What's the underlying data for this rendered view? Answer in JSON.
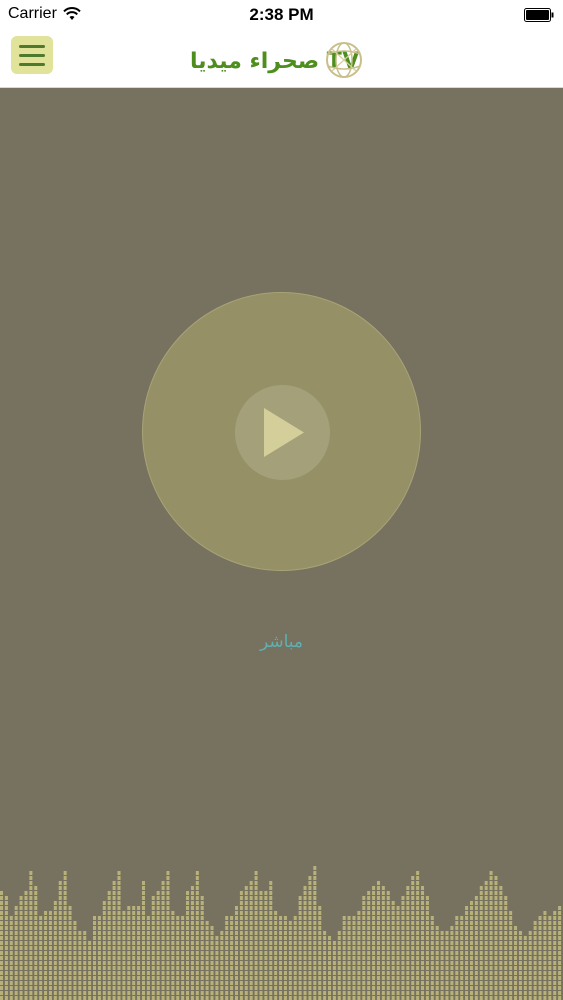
{
  "status": {
    "carrier": "Carrier",
    "time": "2:38 PM"
  },
  "header": {
    "logo_text": "صحراء ميديا TV"
  },
  "player": {
    "live_label": "مباشر"
  },
  "colors": {
    "background": "#777160",
    "accent": "#e1e39a",
    "live": "#5fb0b0",
    "bar": "#b8b27a"
  },
  "equalizer": {
    "levels": [
      0.8,
      0.75,
      0.6,
      0.7,
      0.75,
      0.78,
      0.95,
      0.82,
      0.6,
      0.66,
      0.66,
      0.72,
      0.85,
      0.95,
      0.7,
      0.58,
      0.5,
      0.5,
      0.45,
      0.6,
      0.6,
      0.72,
      0.8,
      0.85,
      0.92,
      0.66,
      0.68,
      0.7,
      0.7,
      0.86,
      0.6,
      0.74,
      0.78,
      0.88,
      0.92,
      0.66,
      0.6,
      0.6,
      0.8,
      0.84,
      0.94,
      0.76,
      0.58,
      0.53,
      0.46,
      0.52,
      0.6,
      0.6,
      0.7,
      0.78,
      0.82,
      0.85,
      0.93,
      0.78,
      0.8,
      0.88,
      0.66,
      0.6,
      0.6,
      0.58,
      0.62,
      0.74,
      0.82,
      0.9,
      0.97,
      0.7,
      0.5,
      0.47,
      0.44,
      0.52,
      0.62,
      0.6,
      0.6,
      0.66,
      0.76,
      0.8,
      0.84,
      0.88,
      0.83,
      0.78,
      0.72,
      0.7,
      0.76,
      0.84,
      0.9,
      0.95,
      0.82,
      0.76,
      0.62,
      0.55,
      0.5,
      0.5,
      0.56,
      0.6,
      0.6,
      0.7,
      0.72,
      0.76,
      0.82,
      0.88,
      0.93,
      0.9,
      0.82,
      0.74,
      0.64,
      0.55,
      0.5,
      0.47,
      0.5,
      0.58,
      0.62,
      0.66,
      0.6,
      0.64,
      0.7
    ]
  }
}
